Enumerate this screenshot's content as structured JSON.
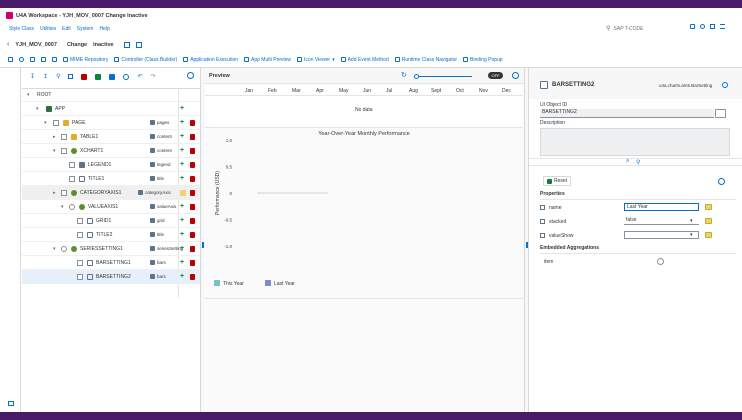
{
  "shell": {
    "title": "U4A Workspace - YJH_MOV_0007 Change Inactive",
    "menus": [
      "Style Class",
      "Utilities",
      "Edit",
      "System",
      "Help"
    ],
    "tcode_placeholder": "SAP T-CODE"
  },
  "subheader": {
    "app_id": "YJH_MOV_0007",
    "mode": "Change",
    "status": "Inactive"
  },
  "toolbar": {
    "items": [
      "MIME Repository",
      "Controller (Class Builder)",
      "Application Execution",
      "App Multi Preview",
      "Icon Viewer",
      "Add Event Method",
      "Runtime Class Navigator",
      "Binding Popup"
    ]
  },
  "tree": {
    "rows": [
      {
        "label": "ROOT",
        "agg": ""
      },
      {
        "label": "APP",
        "agg": ""
      },
      {
        "label": "PAGE",
        "agg": "pages"
      },
      {
        "label": "TABLE1",
        "agg": "content"
      },
      {
        "label": "XCHART1",
        "agg": "content"
      },
      {
        "label": "LEGEND1",
        "agg": "legend"
      },
      {
        "label": "TITLE1",
        "agg": "title"
      },
      {
        "label": "CATEGORYAXIS1",
        "agg": "categoryAxis"
      },
      {
        "label": "VALUEAXIS1",
        "agg": "valueAxis"
      },
      {
        "label": "GRID1",
        "agg": "grid"
      },
      {
        "label": "TITLE2",
        "agg": "title"
      },
      {
        "label": "SERIESSETTING1",
        "agg": "seriesSetting"
      },
      {
        "label": "BARSETTING1",
        "agg": "bars"
      },
      {
        "label": "BARSETTING2",
        "agg": "bars"
      }
    ]
  },
  "preview": {
    "title": "Preview",
    "toggle": "OFF",
    "months": [
      "Jan",
      "Feb",
      "Mar",
      "Apr",
      "May",
      "Jun",
      "Jul",
      "Aug",
      "Sept",
      "Oct",
      "Nov",
      "Dec"
    ],
    "no_data": "No data"
  },
  "chart_data": {
    "type": "bar",
    "title": "Year-Over-Year Monthly Performance",
    "ylabel": "Performance (USD)",
    "xlabel": "",
    "categories": [],
    "ylim": [
      -1.0,
      1.0
    ],
    "yticks": [
      "1.0",
      "0.5",
      "0",
      "-0.5",
      "-1.0"
    ],
    "series": [
      {
        "name": "This Year",
        "color": "#7ac2c9",
        "values": []
      },
      {
        "name": "Last Year",
        "color": "#7b8fc7",
        "values": []
      }
    ]
  },
  "properties": {
    "object_name": "BARSETTING2",
    "object_class": "u4a.charts.am5.BarSetting",
    "ui_object_id_label": "UI Object ID",
    "ui_object_id": "BARSETTING2",
    "description_label": "Description",
    "reset_label": "Reset",
    "section_props": "Properties",
    "props": [
      {
        "name": "name",
        "value": "Last Year"
      },
      {
        "name": "stacked",
        "value": "false"
      },
      {
        "name": "valueShow",
        "value": ""
      }
    ],
    "section_agg": "Embedded Aggregations",
    "agg_items": [
      {
        "name": "item"
      }
    ]
  },
  "colors": {
    "brand": "#4a1a6a",
    "accent": "#0a6ed1",
    "this_year": "#7ac2c9",
    "last_year": "#7b8fc7"
  }
}
